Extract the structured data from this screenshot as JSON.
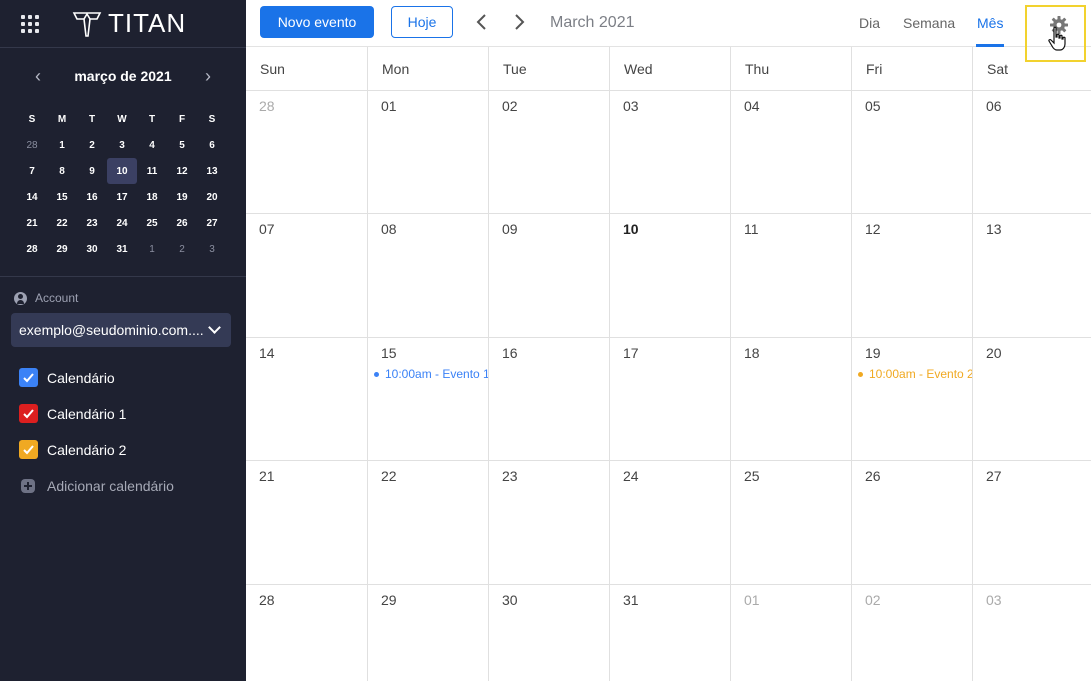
{
  "app": {
    "logo_text": "TITAN"
  },
  "mini_calendar": {
    "title": "março de 2021",
    "weekdays": [
      "S",
      "M",
      "T",
      "W",
      "T",
      "F",
      "S"
    ],
    "weeks": [
      [
        "28",
        "1",
        "2",
        "3",
        "4",
        "5",
        "6"
      ],
      [
        "7",
        "8",
        "9",
        "10",
        "11",
        "12",
        "13"
      ],
      [
        "14",
        "15",
        "16",
        "17",
        "18",
        "19",
        "20"
      ],
      [
        "21",
        "22",
        "23",
        "24",
        "25",
        "26",
        "27"
      ],
      [
        "28",
        "29",
        "30",
        "31",
        "1",
        "2",
        "3"
      ]
    ]
  },
  "account": {
    "label": "Account",
    "email": "exemplo@seudominio.com...."
  },
  "calendars": [
    {
      "name": "Calendário",
      "color": "#3b82f6"
    },
    {
      "name": "Calendário 1",
      "color": "#dc1f1f"
    },
    {
      "name": "Calendário 2",
      "color": "#f0a922"
    }
  ],
  "add_calendar_label": "Adicionar calendário",
  "toolbar": {
    "new_event_label": "Novo evento",
    "today_label": "Hoje",
    "month_title": "March 2021",
    "views": [
      "Dia",
      "Semana",
      "Mês"
    ],
    "active_view": "Mês"
  },
  "grid": {
    "weekdays": [
      "Sun",
      "Mon",
      "Tue",
      "Wed",
      "Thu",
      "Fri",
      "Sat"
    ],
    "weeks": [
      [
        "28",
        "01",
        "02",
        "03",
        "04",
        "05",
        "06"
      ],
      [
        "07",
        "08",
        "09",
        "10",
        "11",
        "12",
        "13"
      ],
      [
        "14",
        "15",
        "16",
        "17",
        "18",
        "19",
        "20"
      ],
      [
        "21",
        "22",
        "23",
        "24",
        "25",
        "26",
        "27"
      ],
      [
        "28",
        "29",
        "30",
        "31",
        "01",
        "02",
        "03"
      ]
    ],
    "events": [
      {
        "text": "10:00am - Evento 1",
        "color": "#3b82f6"
      },
      {
        "text": "10:00am - Evento 2",
        "color": "#f0a922"
      }
    ]
  }
}
